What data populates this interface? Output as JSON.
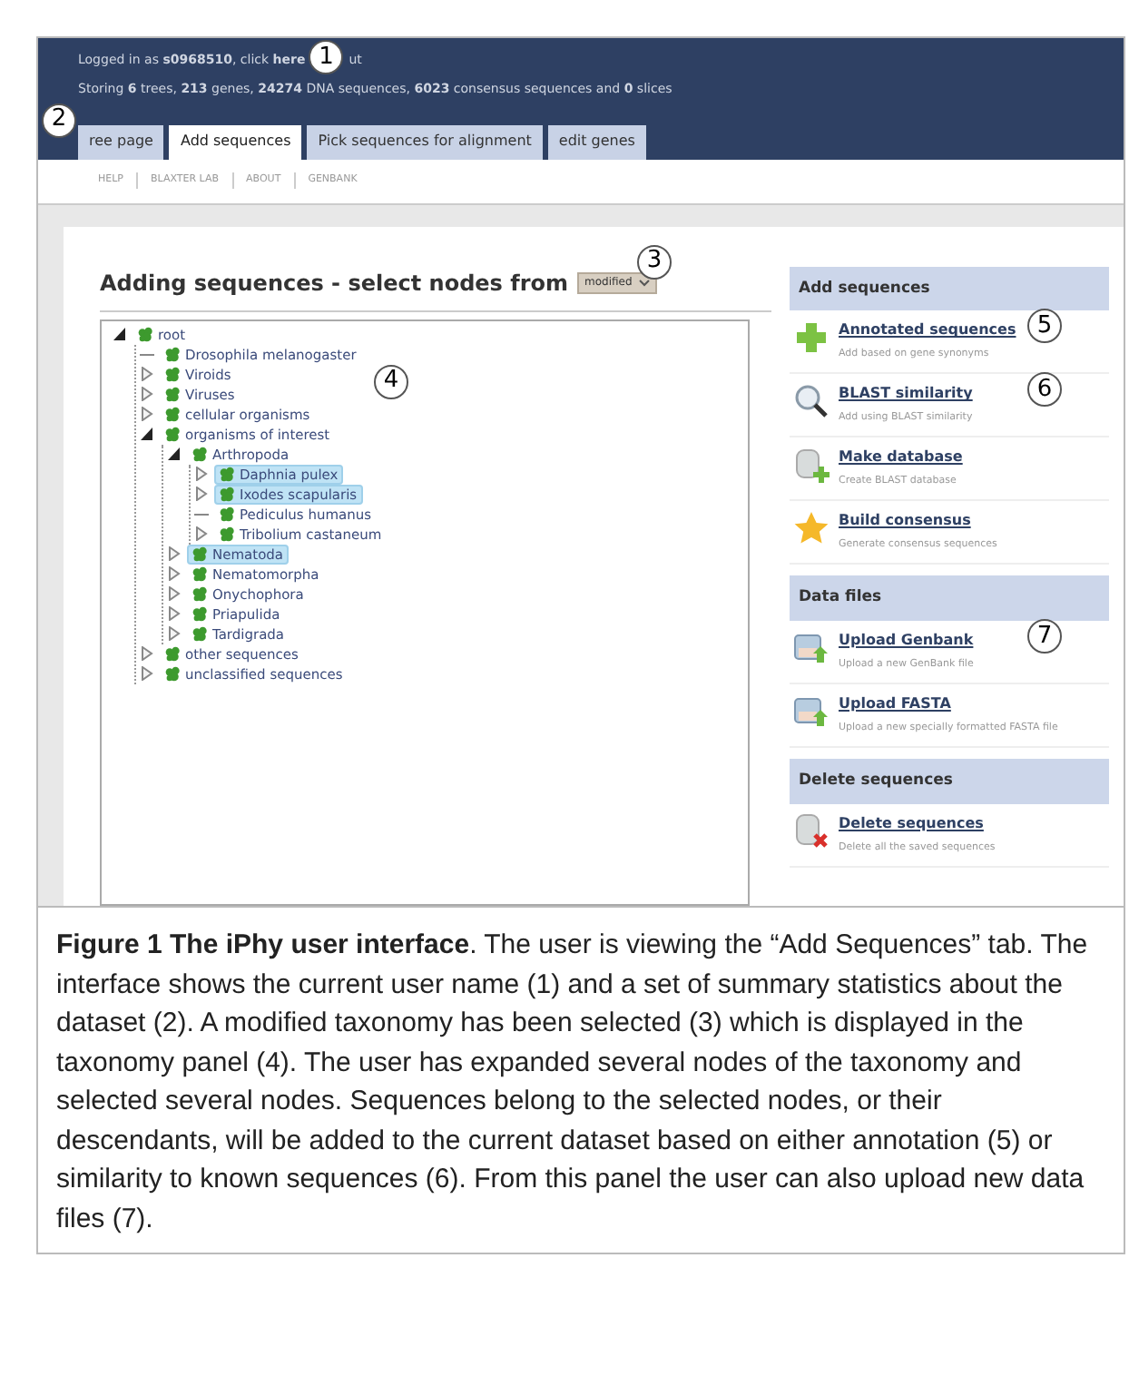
{
  "header": {
    "user_line": "Logged in as **s0968510**, click **here**",
    "user_line_tail": "ut",
    "user_callout": "1",
    "stats_line": "Storing **6** trees, **213** genes, **24274** DNA sequences, **6023** consensus sequences and **0** slices",
    "tabs_callout": "2",
    "tabs": [
      {
        "label": "ree page",
        "selected": false
      },
      {
        "label": "Add sequences",
        "selected": true
      },
      {
        "label": "Pick sequences for alignment",
        "selected": false
      },
      {
        "label": "edit genes",
        "selected": false
      }
    ]
  },
  "nav_links": [
    "HELP",
    "BLAXTER LAB",
    "ABOUT",
    "GENBANK"
  ],
  "main": {
    "heading": "Adding sequences - select nodes from",
    "taxonomy_select": {
      "value": "modified"
    },
    "select_callout": "3",
    "tree_callout": "4",
    "tree": [
      {
        "label": "root",
        "kind": "folder",
        "expanded": true,
        "selected": false,
        "children": [
          {
            "label": "Drosophila melanogaster",
            "kind": "leaf",
            "selected": false
          },
          {
            "label": "Viroids",
            "kind": "folder",
            "expanded": false,
            "selected": false
          },
          {
            "label": "Viruses",
            "kind": "folder",
            "expanded": false,
            "selected": false
          },
          {
            "label": "cellular organisms",
            "kind": "folder",
            "expanded": false,
            "selected": false
          },
          {
            "label": "organisms of interest",
            "kind": "folder",
            "expanded": true,
            "selected": false,
            "children": [
              {
                "label": "Arthropoda",
                "kind": "folder",
                "expanded": true,
                "selected": false,
                "children": [
                  {
                    "label": "Daphnia pulex",
                    "kind": "folder",
                    "expanded": false,
                    "selected": true
                  },
                  {
                    "label": "Ixodes scapularis",
                    "kind": "folder",
                    "expanded": false,
                    "selected": true
                  },
                  {
                    "label": "Pediculus humanus",
                    "kind": "leaf",
                    "selected": false
                  },
                  {
                    "label": "Tribolium castaneum",
                    "kind": "folder",
                    "expanded": false,
                    "selected": false
                  }
                ]
              },
              {
                "label": "Nematoda",
                "kind": "folder",
                "expanded": false,
                "selected": true
              },
              {
                "label": "Nematomorpha",
                "kind": "folder",
                "expanded": false,
                "selected": false
              },
              {
                "label": "Onychophora",
                "kind": "folder",
                "expanded": false,
                "selected": false
              },
              {
                "label": "Priapulida",
                "kind": "folder",
                "expanded": false,
                "selected": false
              },
              {
                "label": "Tardigrada",
                "kind": "folder",
                "expanded": false,
                "selected": false
              }
            ]
          },
          {
            "label": "other sequences",
            "kind": "folder",
            "expanded": false,
            "selected": false
          },
          {
            "label": "unclassified sequences",
            "kind": "folder",
            "expanded": false,
            "selected": false
          }
        ]
      }
    ]
  },
  "sidebar": [
    {
      "title": "Add sequences",
      "items": [
        {
          "kind": "add",
          "title": "Annotated sequences",
          "subtitle": "Add based on gene synonyms",
          "callout": "5"
        },
        {
          "kind": "search",
          "title": "BLAST similarity",
          "subtitle": "Add using BLAST similarity",
          "callout": "6"
        },
        {
          "kind": "database",
          "title": "Make database",
          "subtitle": "Create BLAST database"
        },
        {
          "kind": "star",
          "title": "Build consensus",
          "subtitle": "Generate consensus sequences"
        }
      ]
    },
    {
      "title": "Data files",
      "items": [
        {
          "kind": "upload",
          "title": "Upload Genbank",
          "subtitle": "Upload a new GenBank file",
          "callout": "7"
        },
        {
          "kind": "upload",
          "title": "Upload FASTA",
          "subtitle": "Upload a new specially formatted FASTA file"
        }
      ]
    },
    {
      "title": "Delete sequences",
      "items": [
        {
          "kind": "delete",
          "title": "Delete sequences",
          "subtitle": "Delete all the saved sequences"
        }
      ]
    }
  ],
  "caption": "**Figure 1 The iPhy user interface**. The user is viewing the “Add Sequences” tab. The interface shows the current user name (1) and a set of summary statistics about the dataset (2). A modified taxonomy has been selected (3) which is displayed in the taxonomy panel (4). The user has expanded several nodes of the taxonomy and selected several nodes. Sequences belong to the selected nodes, or their descendants, will be added to the current dataset based on either annotation (5) or similarity to known sequences (6). From this panel the user can also upload new data files (7)."
}
